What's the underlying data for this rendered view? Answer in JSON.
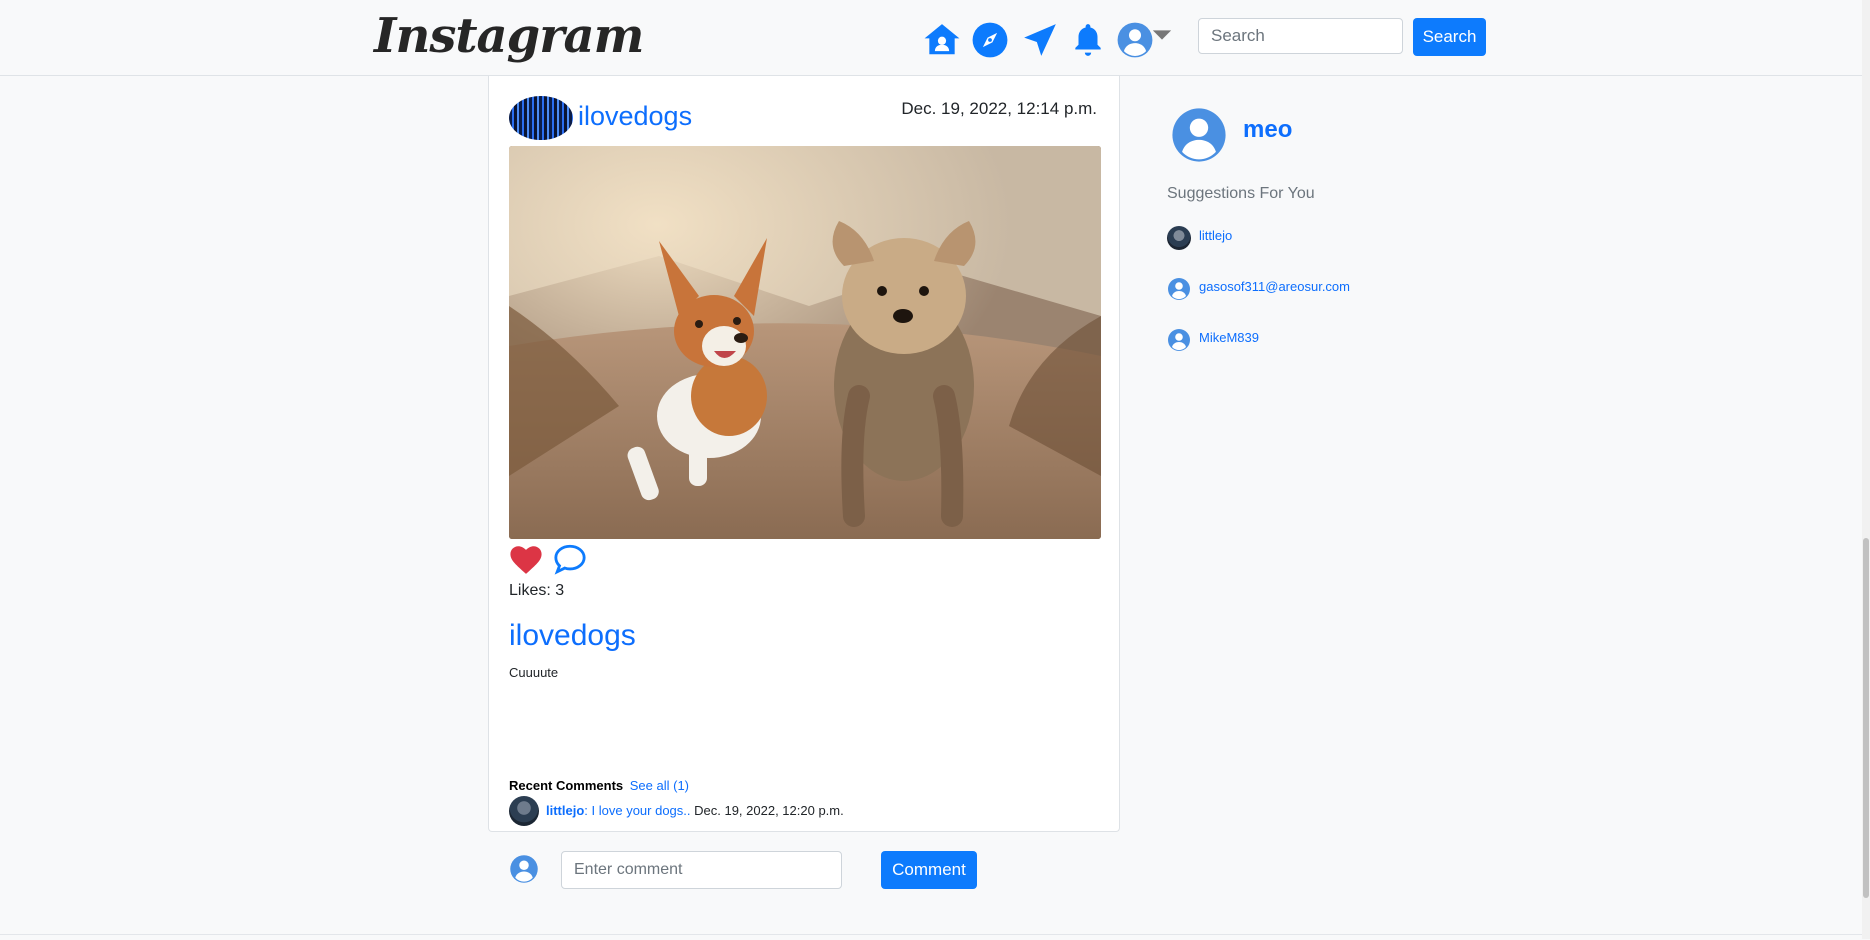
{
  "navbar": {
    "brand": "Instagram",
    "icons": [
      "home-icon",
      "explore-icon",
      "direct-message-icon",
      "notifications-bell-icon",
      "profile-icon",
      "chevron-down-icon"
    ],
    "search_placeholder": "Search",
    "search_button": "Search"
  },
  "post": {
    "author": "ilovedogs",
    "date": "Dec. 19, 2022, 12:14 p.m.",
    "likes_label": "Likes: 3",
    "title": "ilovedogs",
    "caption": "Cuuuute",
    "recent_comments_label": "Recent Comments",
    "see_all": "See all (1)",
    "comments": [
      {
        "user": "littlejo",
        "text": ": I love your dogs..",
        "date": " Dec. 19, 2022, 12:20 p.m."
      }
    ],
    "comment_placeholder": "Enter comment",
    "comment_button": "Comment"
  },
  "sidebar": {
    "username": "meo",
    "suggestions_label": "Suggestions For You",
    "suggestions": [
      {
        "name": "littlejo"
      },
      {
        "name": "gasosof311@areosur.com"
      },
      {
        "name": "MikeM839"
      }
    ]
  },
  "colors": {
    "accent": "#0d6efd",
    "heart": "#dc3545",
    "default_avatar": "#4a90e2"
  }
}
